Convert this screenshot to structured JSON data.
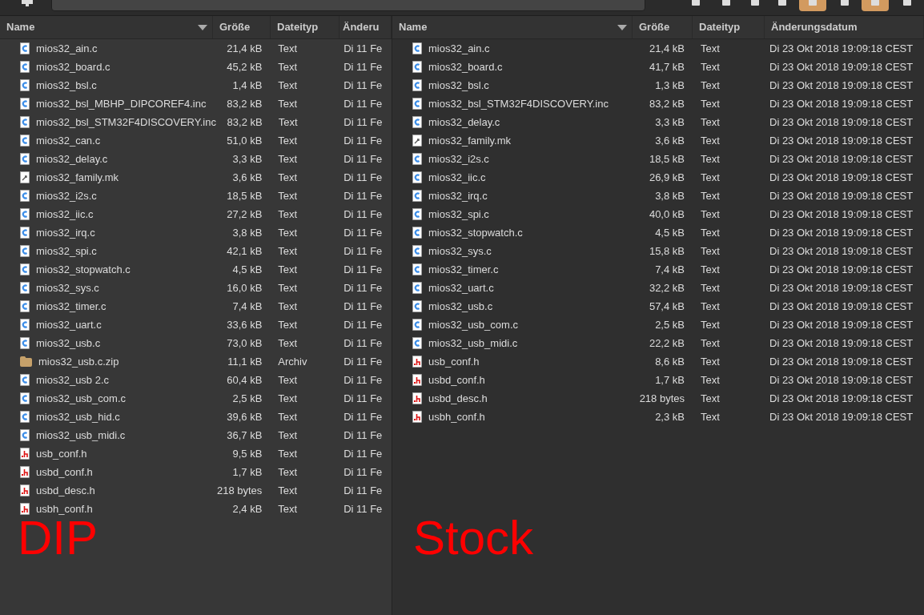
{
  "toolbar": {
    "buttons": [
      {
        "selected": false
      },
      {
        "selected": false
      },
      {
        "selected": false
      },
      {
        "selected": false
      },
      {
        "selected": true
      },
      {
        "selected": false
      },
      {
        "selected": true
      },
      {
        "selected": false
      }
    ]
  },
  "panes": [
    {
      "columns": [
        {
          "label": "Name",
          "sorted": true
        },
        {
          "label": "Größe",
          "sorted": false
        },
        {
          "label": "Dateityp",
          "sorted": false
        },
        {
          "label": "Änderu",
          "sorted": false
        }
      ],
      "rows": [
        {
          "kind": "c",
          "name": "mios32_ain.c",
          "size": "21,4 kB",
          "type": "Text",
          "date": "Di 11 Fe"
        },
        {
          "kind": "c",
          "name": "mios32_board.c",
          "size": "45,2 kB",
          "type": "Text",
          "date": "Di 11 Fe"
        },
        {
          "kind": "c",
          "name": "mios32_bsl.c",
          "size": "1,4 kB",
          "type": "Text",
          "date": "Di 11 Fe"
        },
        {
          "kind": "c",
          "name": "mios32_bsl_MBHP_DIPCOREF4.inc",
          "size": "83,2 kB",
          "type": "Text",
          "date": "Di 11 Fe"
        },
        {
          "kind": "c",
          "name": "mios32_bsl_STM32F4DISCOVERY.inc",
          "size": "83,2 kB",
          "type": "Text",
          "date": "Di 11 Fe"
        },
        {
          "kind": "c",
          "name": "mios32_can.c",
          "size": "51,0 kB",
          "type": "Text",
          "date": "Di 11 Fe"
        },
        {
          "kind": "c",
          "name": "mios32_delay.c",
          "size": "3,3 kB",
          "type": "Text",
          "date": "Di 11 Fe"
        },
        {
          "kind": "mk",
          "name": "mios32_family.mk",
          "size": "3,6 kB",
          "type": "Text",
          "date": "Di 11 Fe"
        },
        {
          "kind": "c",
          "name": "mios32_i2s.c",
          "size": "18,5 kB",
          "type": "Text",
          "date": "Di 11 Fe"
        },
        {
          "kind": "c",
          "name": "mios32_iic.c",
          "size": "27,2 kB",
          "type": "Text",
          "date": "Di 11 Fe"
        },
        {
          "kind": "c",
          "name": "mios32_irq.c",
          "size": "3,8 kB",
          "type": "Text",
          "date": "Di 11 Fe"
        },
        {
          "kind": "c",
          "name": "mios32_spi.c",
          "size": "42,1 kB",
          "type": "Text",
          "date": "Di 11 Fe"
        },
        {
          "kind": "c",
          "name": "mios32_stopwatch.c",
          "size": "4,5 kB",
          "type": "Text",
          "date": "Di 11 Fe"
        },
        {
          "kind": "c",
          "name": "mios32_sys.c",
          "size": "16,0 kB",
          "type": "Text",
          "date": "Di 11 Fe"
        },
        {
          "kind": "c",
          "name": "mios32_timer.c",
          "size": "7,4 kB",
          "type": "Text",
          "date": "Di 11 Fe"
        },
        {
          "kind": "c",
          "name": "mios32_uart.c",
          "size": "33,6 kB",
          "type": "Text",
          "date": "Di 11 Fe"
        },
        {
          "kind": "c",
          "name": "mios32_usb.c",
          "size": "73,0 kB",
          "type": "Text",
          "date": "Di 11 Fe"
        },
        {
          "kind": "archive",
          "name": "mios32_usb.c.zip",
          "size": "11,1 kB",
          "type": "Archiv",
          "date": "Di 11 Fe"
        },
        {
          "kind": "c",
          "name": "mios32_usb 2.c",
          "size": "60,4 kB",
          "type": "Text",
          "date": "Di 11 Fe"
        },
        {
          "kind": "c",
          "name": "mios32_usb_com.c",
          "size": "2,5 kB",
          "type": "Text",
          "date": "Di 11 Fe"
        },
        {
          "kind": "c",
          "name": "mios32_usb_hid.c",
          "size": "39,6 kB",
          "type": "Text",
          "date": "Di 11 Fe"
        },
        {
          "kind": "c",
          "name": "mios32_usb_midi.c",
          "size": "36,7 kB",
          "type": "Text",
          "date": "Di 11 Fe"
        },
        {
          "kind": "h",
          "name": "usb_conf.h",
          "size": "9,5 kB",
          "type": "Text",
          "date": "Di 11 Fe"
        },
        {
          "kind": "h",
          "name": "usbd_conf.h",
          "size": "1,7 kB",
          "type": "Text",
          "date": "Di 11 Fe"
        },
        {
          "kind": "h",
          "name": "usbd_desc.h",
          "size": "218 bytes",
          "type": "Text",
          "date": "Di 11 Fe"
        },
        {
          "kind": "h",
          "name": "usbh_conf.h",
          "size": "2,4 kB",
          "type": "Text",
          "date": "Di 11 Fe"
        }
      ],
      "annotation": "DIP"
    },
    {
      "columns": [
        {
          "label": "Name",
          "sorted": true
        },
        {
          "label": "Größe",
          "sorted": false
        },
        {
          "label": "Dateityp",
          "sorted": false
        },
        {
          "label": "Änderungsdatum",
          "sorted": false
        }
      ],
      "rows": [
        {
          "kind": "c",
          "name": "mios32_ain.c",
          "size": "21,4 kB",
          "type": "Text",
          "date": "Di 23 Okt 2018 19:09:18 CEST"
        },
        {
          "kind": "c",
          "name": "mios32_board.c",
          "size": "41,7 kB",
          "type": "Text",
          "date": "Di 23 Okt 2018 19:09:18 CEST"
        },
        {
          "kind": "c",
          "name": "mios32_bsl.c",
          "size": "1,3 kB",
          "type": "Text",
          "date": "Di 23 Okt 2018 19:09:18 CEST"
        },
        {
          "kind": "c",
          "name": "mios32_bsl_STM32F4DISCOVERY.inc",
          "size": "83,2 kB",
          "type": "Text",
          "date": "Di 23 Okt 2018 19:09:18 CEST"
        },
        {
          "kind": "c",
          "name": "mios32_delay.c",
          "size": "3,3 kB",
          "type": "Text",
          "date": "Di 23 Okt 2018 19:09:18 CEST"
        },
        {
          "kind": "mk",
          "name": "mios32_family.mk",
          "size": "3,6 kB",
          "type": "Text",
          "date": "Di 23 Okt 2018 19:09:18 CEST"
        },
        {
          "kind": "c",
          "name": "mios32_i2s.c",
          "size": "18,5 kB",
          "type": "Text",
          "date": "Di 23 Okt 2018 19:09:18 CEST"
        },
        {
          "kind": "c",
          "name": "mios32_iic.c",
          "size": "26,9 kB",
          "type": "Text",
          "date": "Di 23 Okt 2018 19:09:18 CEST"
        },
        {
          "kind": "c",
          "name": "mios32_irq.c",
          "size": "3,8 kB",
          "type": "Text",
          "date": "Di 23 Okt 2018 19:09:18 CEST"
        },
        {
          "kind": "c",
          "name": "mios32_spi.c",
          "size": "40,0 kB",
          "type": "Text",
          "date": "Di 23 Okt 2018 19:09:18 CEST"
        },
        {
          "kind": "c",
          "name": "mios32_stopwatch.c",
          "size": "4,5 kB",
          "type": "Text",
          "date": "Di 23 Okt 2018 19:09:18 CEST"
        },
        {
          "kind": "c",
          "name": "mios32_sys.c",
          "size": "15,8 kB",
          "type": "Text",
          "date": "Di 23 Okt 2018 19:09:18 CEST"
        },
        {
          "kind": "c",
          "name": "mios32_timer.c",
          "size": "7,4 kB",
          "type": "Text",
          "date": "Di 23 Okt 2018 19:09:18 CEST"
        },
        {
          "kind": "c",
          "name": "mios32_uart.c",
          "size": "32,2 kB",
          "type": "Text",
          "date": "Di 23 Okt 2018 19:09:18 CEST"
        },
        {
          "kind": "c",
          "name": "mios32_usb.c",
          "size": "57,4 kB",
          "type": "Text",
          "date": "Di 23 Okt 2018 19:09:18 CEST"
        },
        {
          "kind": "c",
          "name": "mios32_usb_com.c",
          "size": "2,5 kB",
          "type": "Text",
          "date": "Di 23 Okt 2018 19:09:18 CEST"
        },
        {
          "kind": "c",
          "name": "mios32_usb_midi.c",
          "size": "22,2 kB",
          "type": "Text",
          "date": "Di 23 Okt 2018 19:09:18 CEST"
        },
        {
          "kind": "h",
          "name": "usb_conf.h",
          "size": "8,6 kB",
          "type": "Text",
          "date": "Di 23 Okt 2018 19:09:18 CEST"
        },
        {
          "kind": "h",
          "name": "usbd_conf.h",
          "size": "1,7 kB",
          "type": "Text",
          "date": "Di 23 Okt 2018 19:09:18 CEST"
        },
        {
          "kind": "h",
          "name": "usbd_desc.h",
          "size": "218 bytes",
          "type": "Text",
          "date": "Di 23 Okt 2018 19:09:18 CEST"
        },
        {
          "kind": "h",
          "name": "usbh_conf.h",
          "size": "2,3 kB",
          "type": "Text",
          "date": "Di 23 Okt 2018 19:09:18 CEST"
        }
      ],
      "annotation": "Stock"
    }
  ]
}
